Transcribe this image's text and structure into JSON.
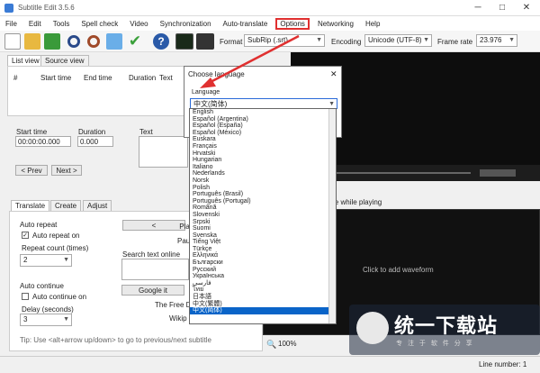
{
  "window": {
    "title": "Subtitle Edit 3.5.6",
    "minimize": "─",
    "maximize": "□",
    "close": "✕"
  },
  "menu": [
    "File",
    "Edit",
    "Tools",
    "Spell check",
    "Video",
    "Synchronization",
    "Auto-translate",
    "Options",
    "Networking",
    "Help"
  ],
  "toolbar": {
    "format_label": "Format",
    "format_value": "SubRip (.srt)",
    "encoding_label": "Encoding",
    "encoding_value": "Unicode (UTF-8)",
    "framerate_label": "Frame rate",
    "framerate_value": "23.976"
  },
  "tabs": {
    "list_view": "List view",
    "source_view": "Source view"
  },
  "grid_headers": [
    "#",
    "Start time",
    "End time",
    "Duration",
    "Text"
  ],
  "editor": {
    "start_label": "Start time",
    "start_value": "00:00:00.000",
    "duration_label": "Duration",
    "duration_value": "0.000",
    "text_label": "Text",
    "prev": "< Prev",
    "next": "Next >"
  },
  "bottom_tabs": [
    "Translate",
    "Create",
    "Adjust"
  ],
  "translate": {
    "auto_repeat": "Auto repeat",
    "auto_repeat_on": "Auto repeat on",
    "repeat_count_label": "Repeat count (times)",
    "repeat_count_value": "2",
    "auto_continue": "Auto continue",
    "auto_continue_on": "Auto continue on",
    "delay_label": "Delay (seconds)",
    "delay_value": "3",
    "back": "<",
    "play": "Pla",
    "pause": "Paus",
    "search_label": "Search text online",
    "google": "Google it",
    "free_dict": "The Free D",
    "wiki": "Wikip",
    "tip": "Tip: Use <alt+arrow up/down> to go to previous/next subtitle"
  },
  "video": {
    "subtitle_label": "le while playing",
    "waveform": "Click to add waveform",
    "zoom": "100%"
  },
  "dialog": {
    "title": "Choose language",
    "close": "✕",
    "language_label": "Language",
    "selected": "中文(简体)"
  },
  "languages": [
    "English",
    "Español (Argentina)",
    "Español (España)",
    "Español (México)",
    "Euskara",
    "Français",
    "Hrvatski",
    "Hungarian",
    "Italiano",
    "Nederlands",
    "Norsk",
    "Polish",
    "Português (Brasil)",
    "Português (Portugal)",
    "Română",
    "Slovenski",
    "Srpski",
    "Suomi",
    "Svenska",
    "Tiếng Việt",
    "Türkçe",
    "Ελληνικά",
    "Български",
    "Русский",
    "Українська",
    "فارسی",
    "ไทย",
    "日本語",
    "中文(繁體)",
    "中文(简体)"
  ],
  "status": {
    "line_number": "Line number: 1"
  },
  "watermark": {
    "text": "统一下载站",
    "sub": "专 注 于 软 件 分 享"
  }
}
